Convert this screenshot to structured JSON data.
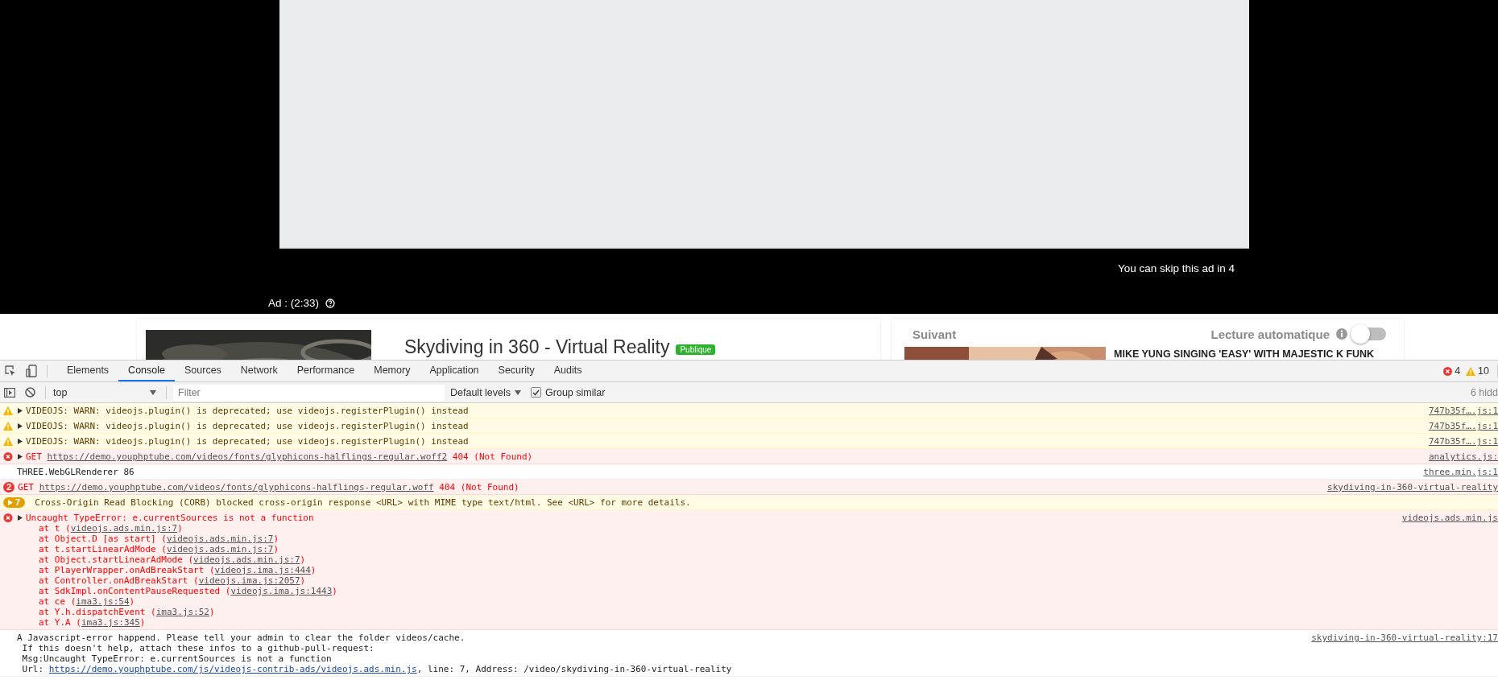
{
  "video_player": {
    "skip_notice": "You can skip this ad in 4",
    "ad_label": "Ad : (2:33)"
  },
  "video_card": {
    "title": "Skydiving in 360 - Virtual Reality",
    "badge": "Publique"
  },
  "up_next": {
    "heading": "Suivant",
    "autoplay_label": "Lecture automatique",
    "autoplay_on": false,
    "items": [
      {
        "title": "MIKE YUNG SINGING 'EASY' WITH MAJESTIC K FUNK"
      }
    ]
  },
  "devtools": {
    "tabs": [
      {
        "label": "Elements",
        "selected": false
      },
      {
        "label": "Console",
        "selected": true
      },
      {
        "label": "Sources",
        "selected": false
      },
      {
        "label": "Network",
        "selected": false
      },
      {
        "label": "Performance",
        "selected": false
      },
      {
        "label": "Memory",
        "selected": false
      },
      {
        "label": "Application",
        "selected": false
      },
      {
        "label": "Security",
        "selected": false
      },
      {
        "label": "Audits",
        "selected": false
      }
    ],
    "error_count": "4",
    "warning_count": "10",
    "toolbar": {
      "context": "top",
      "filter_placeholder": "Filter",
      "levels": "Default levels",
      "group_similar": true,
      "group_label": "Group similar",
      "hidden_note": "6 hidd"
    },
    "messages": [
      {
        "kind": "warning",
        "expandable": true,
        "lines": [
          [
            {
              "text": "VIDEOJS: WARN: videojs.plugin() is deprecated; use videojs.registerPlugin() instead"
            }
          ]
        ],
        "source": "747b35f….js:1"
      },
      {
        "kind": "warning",
        "expandable": true,
        "lines": [
          [
            {
              "text": "VIDEOJS: WARN: videojs.plugin() is deprecated; use videojs.registerPlugin() instead"
            }
          ]
        ],
        "source": "747b35f….js:1"
      },
      {
        "kind": "warning",
        "expandable": true,
        "lines": [
          [
            {
              "text": "VIDEOJS: WARN: videojs.plugin() is deprecated; use videojs.registerPlugin() instead"
            }
          ]
        ],
        "source": "747b35f….js:1"
      },
      {
        "kind": "error",
        "expandable": true,
        "lines": [
          [
            {
              "text": "GET "
            },
            {
              "text": "https://demo.youphptube.com/videos/fonts/glyphicons-halflings-regular.woff2",
              "link": true
            },
            {
              "text": " 404 (Not Found)"
            }
          ]
        ],
        "source": "analytics.js:"
      },
      {
        "kind": "log",
        "expandable": false,
        "lines": [
          [
            {
              "text": "THREE.WebGLRenderer 86"
            }
          ]
        ],
        "source": "three.min.js:1"
      },
      {
        "kind": "error",
        "count": "2",
        "expandable": false,
        "lines": [
          [
            {
              "text": "GET "
            },
            {
              "text": "https://demo.youphptube.com/videos/fonts/glyphicons-halflings-regular.woff",
              "link": true
            },
            {
              "text": " 404 (Not Found)"
            }
          ]
        ],
        "source": "skydiving-in-360-virtual-reality"
      },
      {
        "kind": "warning",
        "count": "7",
        "expandable": true,
        "lines": [
          [
            {
              "text": "Cross-Origin Read Blocking (CORB) blocked cross-origin response <URL> with MIME type text/html. See <URL> for more details."
            }
          ]
        ]
      },
      {
        "kind": "error",
        "expandable": true,
        "lines": [
          [
            {
              "text": "Uncaught TypeError: e.currentSources is not a function"
            }
          ]
        ],
        "stack": [
          [
            {
              "text": "at t ("
            },
            {
              "text": "videojs.ads.min.js:7",
              "link": true
            },
            {
              "text": ")"
            }
          ],
          [
            {
              "text": "at Object.D [as start] ("
            },
            {
              "text": "videojs.ads.min.js:7",
              "link": true
            },
            {
              "text": ")"
            }
          ],
          [
            {
              "text": "at t.startLinearAdMode ("
            },
            {
              "text": "videojs.ads.min.js:7",
              "link": true
            },
            {
              "text": ")"
            }
          ],
          [
            {
              "text": "at Object.startLinearAdMode ("
            },
            {
              "text": "videojs.ads.min.js:7",
              "link": true
            },
            {
              "text": ")"
            }
          ],
          [
            {
              "text": "at PlayerWrapper.onAdBreakStart ("
            },
            {
              "text": "videojs.ima.js:444",
              "link": true
            },
            {
              "text": ")"
            }
          ],
          [
            {
              "text": "at Controller.onAdBreakStart ("
            },
            {
              "text": "videojs.ima.js:2057",
              "link": true
            },
            {
              "text": ")"
            }
          ],
          [
            {
              "text": "at SdkImpl.onContentPauseRequested ("
            },
            {
              "text": "videojs.ima.js:1443",
              "link": true
            },
            {
              "text": ")"
            }
          ],
          [
            {
              "text": "at ce ("
            },
            {
              "text": "ima3.js:54",
              "link": true
            },
            {
              "text": ")"
            }
          ],
          [
            {
              "text": "at Y.h.dispatchEvent ("
            },
            {
              "text": "ima3.js:52",
              "link": true
            },
            {
              "text": ")"
            }
          ],
          [
            {
              "text": "at Y.A ("
            },
            {
              "text": "ima3.js:345",
              "link": true
            },
            {
              "text": ")"
            }
          ]
        ],
        "source": "videojs.ads.min.js"
      },
      {
        "kind": "log",
        "expandable": false,
        "lines": [
          [
            {
              "text": "A Javascript-error happend. Please tell your admin to clear the folder videos/cache."
            }
          ],
          [
            {
              "text": " If this doesn't help, attach these infos to a github-pull-request:"
            }
          ],
          [
            {
              "text": " Msg:Uncaught TypeError: e.currentSources is not a function"
            }
          ],
          [
            {
              "text": " Url: "
            },
            {
              "text": "https://demo.youphptube.com/js/videojs-contrib-ads/videojs.ads.min.js",
              "link": true
            },
            {
              "text": ", line: 7, Address: /video/skydiving-in-360-virtual-reality"
            }
          ]
        ],
        "source": "skydiving-in-360-virtual-reality:17"
      }
    ]
  }
}
